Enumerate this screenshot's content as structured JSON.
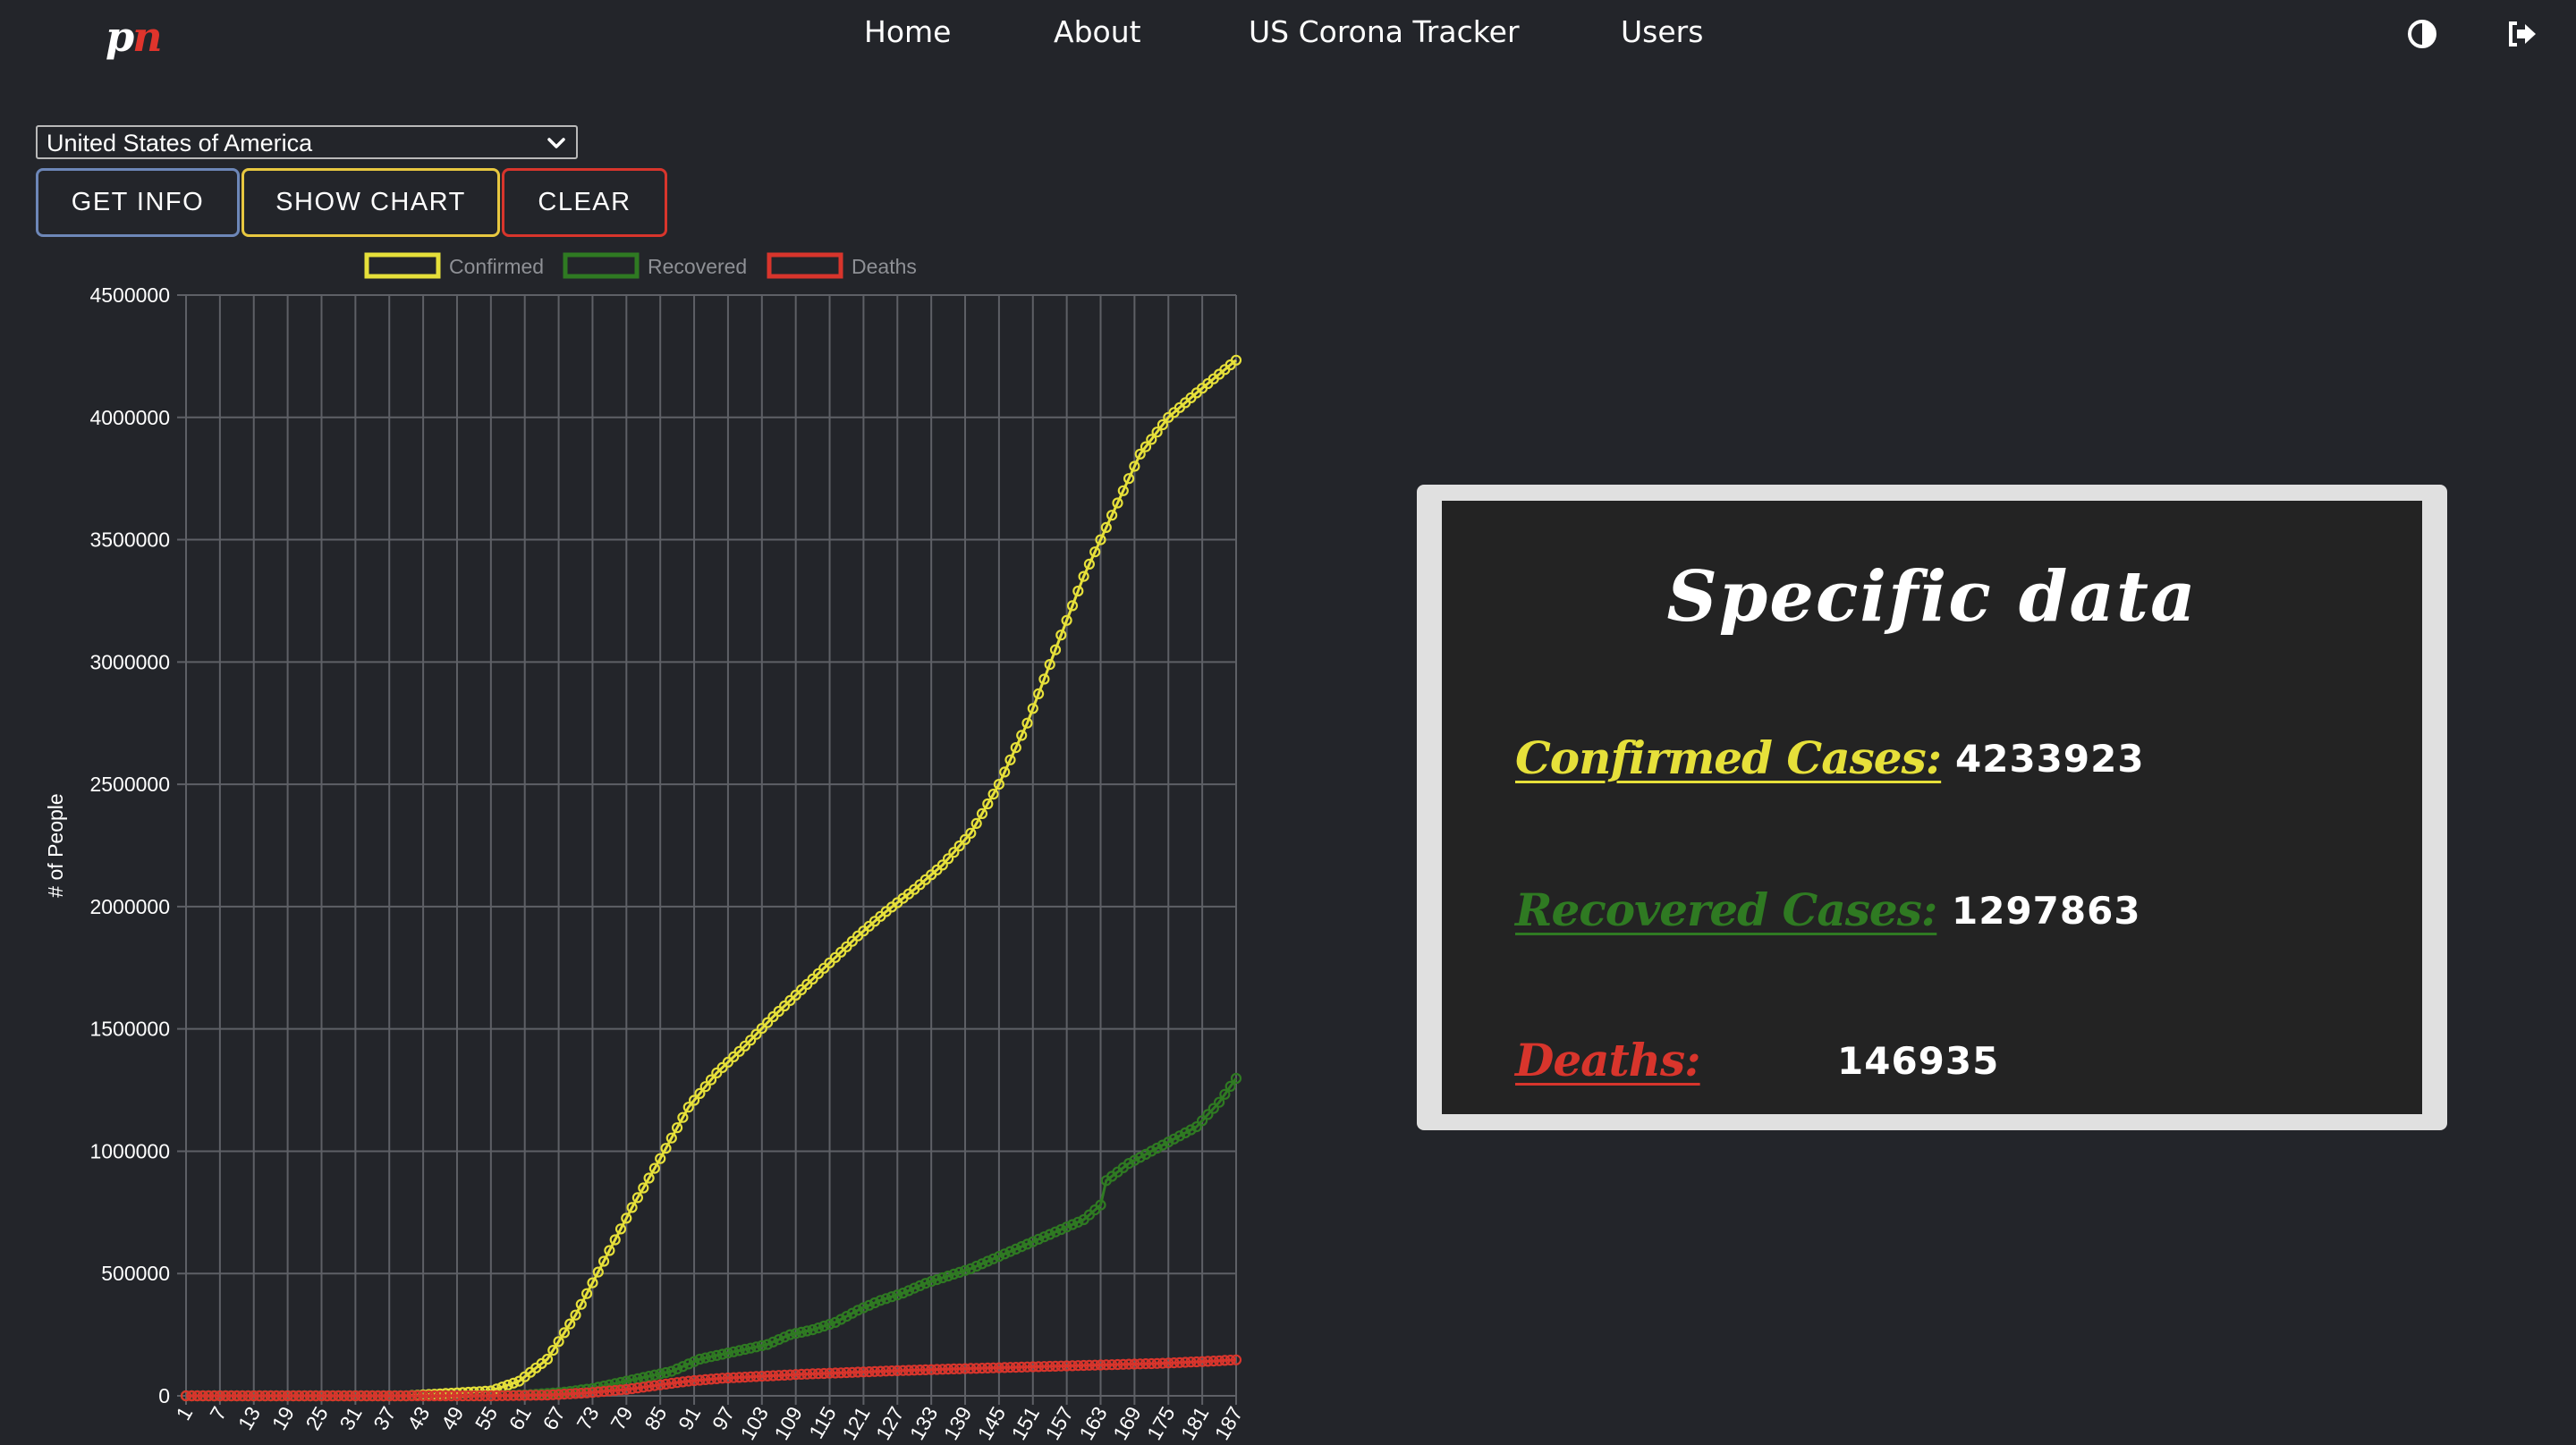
{
  "nav": {
    "logo_p": "p",
    "logo_n": "n",
    "links": [
      "Home",
      "About",
      "US Corona Tracker",
      "Users"
    ],
    "icons": [
      "theme-toggle-icon",
      "logout-icon"
    ]
  },
  "controls": {
    "country_selected": "United States of America",
    "get_info_label": "GET INFO",
    "show_chart_label": "SHOW CHART",
    "clear_label": "CLEAR"
  },
  "chart_data": {
    "type": "line",
    "ylabel": "# of People",
    "ylim": [
      0,
      4500000
    ],
    "yticks": [
      0,
      500000,
      1000000,
      1500000,
      2000000,
      2500000,
      3000000,
      3500000,
      4000000,
      4500000
    ],
    "x_start": 1,
    "x_end": 187,
    "xtick_labels": [
      1,
      7,
      13,
      19,
      25,
      31,
      37,
      43,
      49,
      55,
      61,
      67,
      73,
      79,
      85,
      91,
      97,
      103,
      109,
      115,
      121,
      127,
      133,
      139,
      145,
      151,
      157,
      163,
      169,
      175,
      181,
      187
    ],
    "legend_position": "top",
    "grid": true,
    "series": [
      {
        "name": "Confirmed",
        "color": "#e6e03a",
        "anchors": [
          [
            1,
            1
          ],
          [
            40,
            15
          ],
          [
            55,
            20000
          ],
          [
            60,
            60000
          ],
          [
            65,
            150000
          ],
          [
            70,
            330000
          ],
          [
            75,
            550000
          ],
          [
            80,
            770000
          ],
          [
            85,
            970000
          ],
          [
            90,
            1180000
          ],
          [
            95,
            1320000
          ],
          [
            100,
            1430000
          ],
          [
            105,
            1550000
          ],
          [
            110,
            1660000
          ],
          [
            115,
            1770000
          ],
          [
            120,
            1880000
          ],
          [
            125,
            1980000
          ],
          [
            130,
            2070000
          ],
          [
            135,
            2170000
          ],
          [
            140,
            2300000
          ],
          [
            145,
            2500000
          ],
          [
            150,
            2750000
          ],
          [
            155,
            3050000
          ],
          [
            160,
            3350000
          ],
          [
            165,
            3600000
          ],
          [
            170,
            3850000
          ],
          [
            175,
            4000000
          ],
          [
            180,
            4100000
          ],
          [
            187,
            4233923
          ]
        ]
      },
      {
        "name": "Recovered",
        "color": "#2f7a22",
        "anchors": [
          [
            1,
            0
          ],
          [
            55,
            0
          ],
          [
            62,
            5000
          ],
          [
            68,
            15000
          ],
          [
            73,
            30000
          ],
          [
            78,
            55000
          ],
          [
            83,
            80000
          ],
          [
            87,
            100000
          ],
          [
            92,
            150000
          ],
          [
            96,
            170000
          ],
          [
            100,
            190000
          ],
          [
            104,
            210000
          ],
          [
            108,
            250000
          ],
          [
            112,
            270000
          ],
          [
            116,
            300000
          ],
          [
            120,
            350000
          ],
          [
            124,
            390000
          ],
          [
            128,
            420000
          ],
          [
            132,
            460000
          ],
          [
            136,
            490000
          ],
          [
            140,
            520000
          ],
          [
            144,
            560000
          ],
          [
            148,
            600000
          ],
          [
            152,
            640000
          ],
          [
            156,
            680000
          ],
          [
            160,
            720000
          ],
          [
            163,
            780000
          ],
          [
            164,
            880000
          ],
          [
            168,
            950000
          ],
          [
            172,
            1000000
          ],
          [
            176,
            1050000
          ],
          [
            180,
            1100000
          ],
          [
            184,
            1200000
          ],
          [
            187,
            1297863
          ]
        ]
      },
      {
        "name": "Deaths",
        "color": "#d8352c",
        "anchors": [
          [
            1,
            0
          ],
          [
            55,
            0
          ],
          [
            65,
            3000
          ],
          [
            72,
            12000
          ],
          [
            79,
            26000
          ],
          [
            85,
            45000
          ],
          [
            90,
            60000
          ],
          [
            96,
            72000
          ],
          [
            103,
            80000
          ],
          [
            110,
            88000
          ],
          [
            118,
            95000
          ],
          [
            126,
            102000
          ],
          [
            134,
            108000
          ],
          [
            142,
            113000
          ],
          [
            150,
            118000
          ],
          [
            158,
            123000
          ],
          [
            166,
            128000
          ],
          [
            174,
            133000
          ],
          [
            181,
            140000
          ],
          [
            187,
            146935
          ]
        ]
      }
    ]
  },
  "card": {
    "title": "Specific data",
    "confirmed_label": "Confirmed Cases:",
    "confirmed_value": "4233923",
    "recovered_label": "Recovered Cases:",
    "recovered_value": "1297863",
    "deaths_label": "Deaths:",
    "deaths_value": "146935",
    "colors": {
      "confirmed": "#e6e03a",
      "recovered": "#2f7a22",
      "deaths": "#d8352c"
    }
  }
}
